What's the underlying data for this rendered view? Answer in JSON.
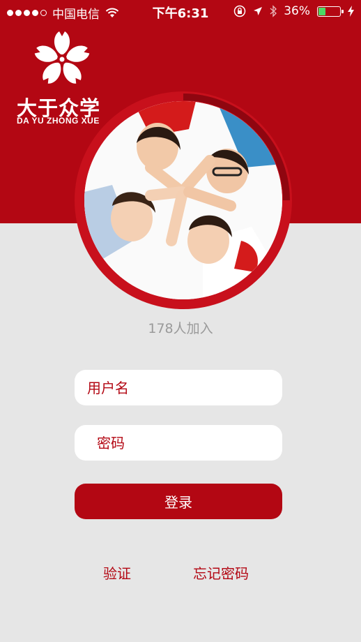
{
  "status_bar": {
    "carrier": "中国电信",
    "time": "下午6:31",
    "battery_percent": "36%",
    "battery_level": 0.36,
    "icons": [
      "signal-dots-icon",
      "wifi-icon",
      "rotation-lock-icon",
      "location-arrow-icon",
      "bluetooth-icon",
      "battery-icon",
      "charging-bolt-icon"
    ]
  },
  "brand": {
    "name_cn": "大于众学",
    "name_en": "DA YU ZHONG XUE",
    "logo_icon": "flower-logo-icon"
  },
  "hero": {
    "join_count": "178人加入",
    "image": "group-of-students-photo"
  },
  "form": {
    "username_placeholder": "用户名",
    "password_placeholder": "密码",
    "login_label": "登录"
  },
  "links": {
    "verify": "验证",
    "forgot_password": "忘记密码"
  },
  "colors": {
    "brand_red": "#b30713",
    "background": "#e6e6e6",
    "muted_text": "#9a9a9a",
    "battery_green": "#4cd964"
  }
}
